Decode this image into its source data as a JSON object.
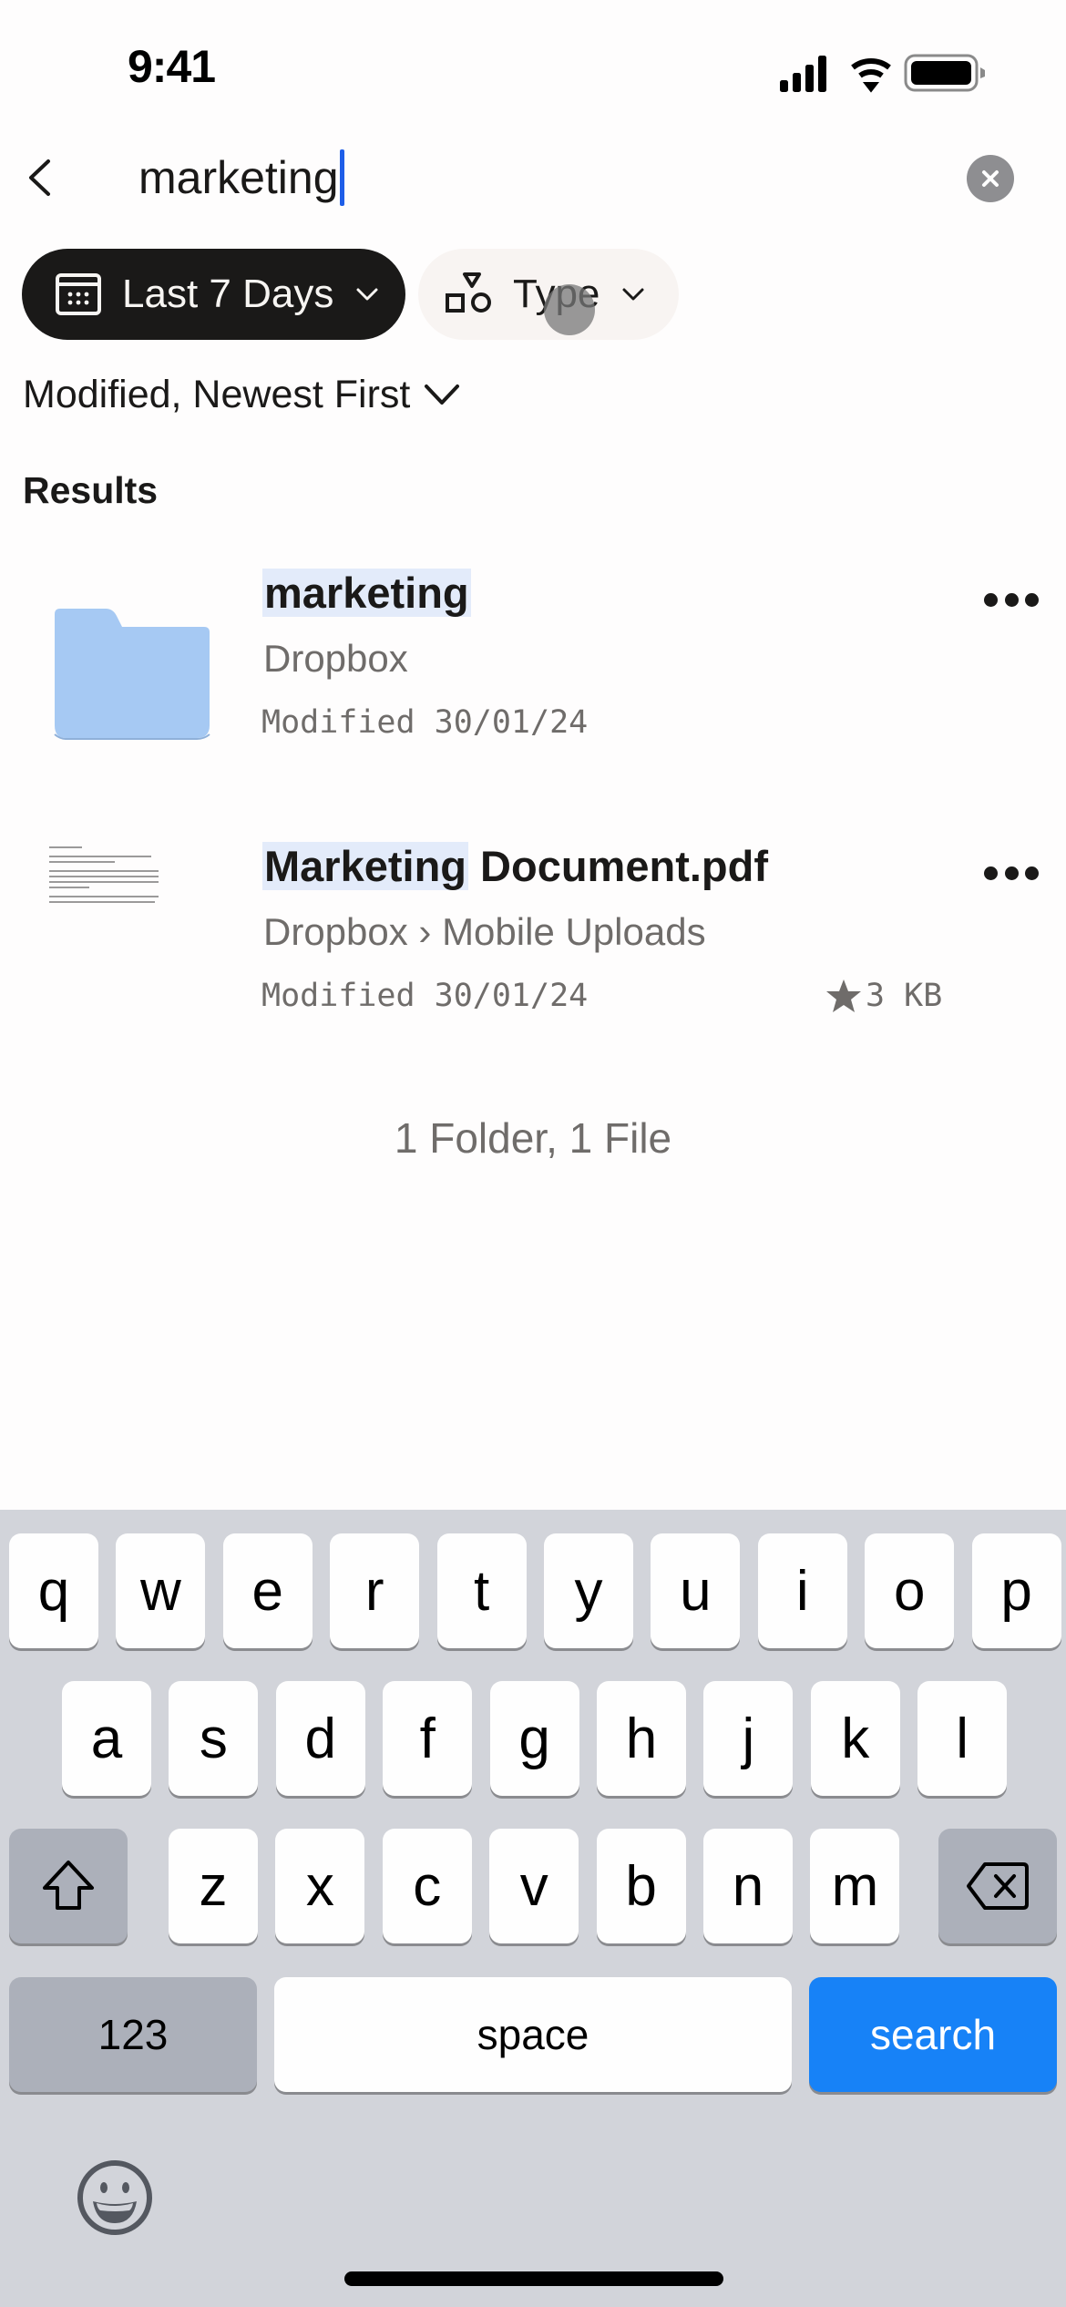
{
  "status_bar": {
    "time": "9:41",
    "icons": [
      "cellular-signal-icon",
      "wifi-icon",
      "battery-icon"
    ]
  },
  "search": {
    "query": "marketing",
    "back_icon": "chevron-left-icon",
    "clear_icon": "clear-x-icon"
  },
  "filters": {
    "date": {
      "label": "Last 7 Days",
      "icon": "calendar-icon",
      "active": true
    },
    "type": {
      "label": "Type",
      "icon": "shapes-icon",
      "active": false
    }
  },
  "sort": {
    "label": "Modified, Newest First"
  },
  "results": {
    "heading": "Results",
    "items": [
      {
        "kind": "folder",
        "name_highlight": "marketing",
        "name_rest": "",
        "path": "Dropbox",
        "modified": "Modified 30/01/24"
      },
      {
        "kind": "pdf",
        "name_highlight": "Marketing",
        "name_rest": " Document.pdf",
        "path": "Dropbox › Mobile Uploads",
        "modified": "Modified 30/01/24",
        "starred": true,
        "size": "3 KB"
      }
    ],
    "summary": "1 Folder, 1 File"
  },
  "keyboard": {
    "row1": [
      "q",
      "w",
      "e",
      "r",
      "t",
      "y",
      "u",
      "i",
      "o",
      "p"
    ],
    "row2": [
      "a",
      "s",
      "d",
      "f",
      "g",
      "h",
      "j",
      "k",
      "l"
    ],
    "row3": [
      "z",
      "x",
      "c",
      "v",
      "b",
      "n",
      "m"
    ],
    "numbers_label": "123",
    "space_label": "space",
    "action_label": "search",
    "shift_icon": "shift-icon",
    "delete_icon": "backspace-icon",
    "emoji_icon": "emoji-icon"
  },
  "colors": {
    "accent_blue": "#1782f7",
    "highlight": "#e3ebfa",
    "folder_blue": "#a6c9f3",
    "chip_active_bg": "#1a1918",
    "caret": "#1e5ee8"
  }
}
